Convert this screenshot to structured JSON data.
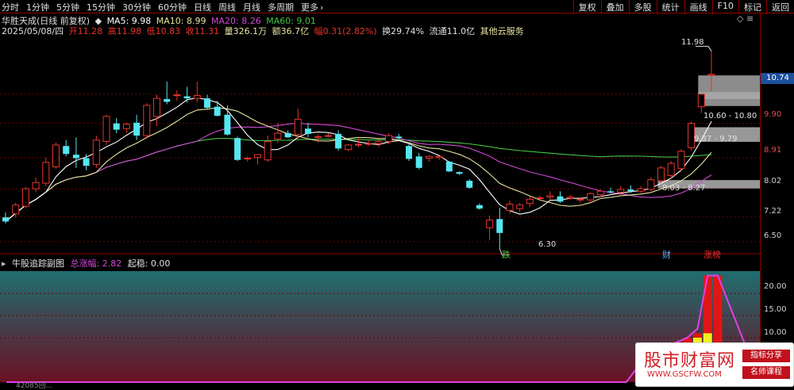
{
  "toolbar": {
    "periods": [
      "分时",
      "1分钟",
      "5分钟",
      "15分钟",
      "30分钟",
      "60分钟",
      "日线",
      "周线",
      "月线",
      "多周期",
      "更多"
    ],
    "more_arrow": "›",
    "right_tools": [
      "复权",
      "叠加",
      "多股",
      "统计",
      "画线",
      "F10",
      "标记",
      "返回"
    ]
  },
  "info": {
    "stock_name": "华胜天成(日线 前复权)",
    "ma_toggle": "◆",
    "ma5": "MA5: 9.98",
    "ma10": "MA10: 8.99",
    "ma20": "MA20: 8.26",
    "ma60": "MA60: 9.01",
    "date": "2025/05/08/四",
    "open": "开11.28",
    "high": "高11.98",
    "low": "低10.83",
    "close": "收11.31",
    "volume": "量326.1万",
    "amount": "额36.7亿",
    "range": "幅0.31(2.82%)",
    "turnover": "换29.74%",
    "float_cap": "流通11.0亿",
    "cloud": "其他云服务",
    "corner_icons": "◇ ≡"
  },
  "axis": {
    "labels": [
      "10.74",
      "9.90",
      "8.91",
      "8.02",
      "7.22",
      "6.50"
    ],
    "current_price": "10.74",
    "sub_labels": [
      "20.00",
      "15.00",
      "10.00"
    ]
  },
  "annotations": {
    "high_label": "11.98",
    "low_label": "6.30",
    "zone1": "10.60 - 10.80",
    "zone2": "9.37 - 9.79",
    "zone3": "8.03 - 8.27",
    "tag_die": "跌",
    "tag_cai": "财",
    "tag_zhangting": "涨榜"
  },
  "sub_chart": {
    "name": "牛股追踪副图",
    "total_label": "总涨幅: 2.82",
    "qiwen_label": "起稳: 0.00"
  },
  "bottom_text": "42085回...",
  "watermark": {
    "title": "股市财富网",
    "url": "WWW.GSCFW.COM",
    "badge1": "指标分享",
    "badge2": "名师课程"
  },
  "colors": {
    "up": "#e8342d",
    "down": "#55e6f0",
    "ma5": "#ffffff",
    "ma10": "#e8e4a0",
    "ma20": "#d14ad6",
    "ma60": "#44c444"
  },
  "chart_data": {
    "type": "candlestick",
    "ylim": [
      6.2,
      12.4
    ],
    "candles": [
      {
        "o": 7.2,
        "h": 7.34,
        "l": 7.02,
        "c": 7.08
      },
      {
        "o": 7.3,
        "h": 7.62,
        "l": 7.2,
        "c": 7.55
      },
      {
        "o": 7.52,
        "h": 8.08,
        "l": 7.46,
        "c": 8.02
      },
      {
        "o": 8.02,
        "h": 8.35,
        "l": 7.92,
        "c": 8.2
      },
      {
        "o": 8.18,
        "h": 8.92,
        "l": 8.1,
        "c": 8.78
      },
      {
        "o": 8.65,
        "h": 9.35,
        "l": 8.6,
        "c": 9.28
      },
      {
        "o": 9.25,
        "h": 9.42,
        "l": 8.95,
        "c": 9.02
      },
      {
        "o": 9.0,
        "h": 9.5,
        "l": 8.62,
        "c": 8.9
      },
      {
        "o": 8.9,
        "h": 9.02,
        "l": 8.55,
        "c": 8.68
      },
      {
        "o": 8.72,
        "h": 9.55,
        "l": 8.62,
        "c": 9.42
      },
      {
        "o": 9.38,
        "h": 10.15,
        "l": 9.28,
        "c": 10.1
      },
      {
        "o": 9.9,
        "h": 10.05,
        "l": 9.62,
        "c": 9.72
      },
      {
        "o": 9.75,
        "h": 9.92,
        "l": 9.62,
        "c": 9.88
      },
      {
        "o": 9.92,
        "h": 10.15,
        "l": 9.42,
        "c": 9.55
      },
      {
        "o": 9.55,
        "h": 10.48,
        "l": 9.45,
        "c": 10.42
      },
      {
        "o": 10.1,
        "h": 10.72,
        "l": 9.82,
        "c": 10.62
      },
      {
        "o": 10.6,
        "h": 11.1,
        "l": 10.45,
        "c": 10.52
      },
      {
        "o": 10.72,
        "h": 10.85,
        "l": 10.55,
        "c": 10.72
      },
      {
        "o": 10.68,
        "h": 10.95,
        "l": 10.5,
        "c": 10.62
      },
      {
        "o": 10.62,
        "h": 11.1,
        "l": 10.5,
        "c": 10.7
      },
      {
        "o": 10.62,
        "h": 10.72,
        "l": 10.3,
        "c": 10.35
      },
      {
        "o": 10.38,
        "h": 10.55,
        "l": 10.1,
        "c": 10.12
      },
      {
        "o": 10.15,
        "h": 10.42,
        "l": 9.55,
        "c": 9.58
      },
      {
        "o": 9.48,
        "h": 9.52,
        "l": 8.82,
        "c": 8.85
      },
      {
        "o": 8.9,
        "h": 8.95,
        "l": 8.8,
        "c": 8.9
      },
      {
        "o": 8.92,
        "h": 9.02,
        "l": 8.72,
        "c": 9.0
      },
      {
        "o": 8.85,
        "h": 9.55,
        "l": 8.8,
        "c": 9.38
      },
      {
        "o": 9.45,
        "h": 9.92,
        "l": 9.35,
        "c": 9.62
      },
      {
        "o": 9.62,
        "h": 9.7,
        "l": 9.48,
        "c": 9.5
      },
      {
        "o": 9.58,
        "h": 10.32,
        "l": 9.45,
        "c": 10.02
      },
      {
        "o": 9.75,
        "h": 9.92,
        "l": 9.5,
        "c": 9.6
      },
      {
        "o": 9.52,
        "h": 9.58,
        "l": 9.35,
        "c": 9.52
      },
      {
        "o": 9.55,
        "h": 9.62,
        "l": 9.5,
        "c": 9.55
      },
      {
        "o": 9.6,
        "h": 9.7,
        "l": 9.12,
        "c": 9.18
      },
      {
        "o": 9.15,
        "h": 9.3,
        "l": 9.1,
        "c": 9.28
      },
      {
        "o": 9.3,
        "h": 9.45,
        "l": 9.22,
        "c": 9.3
      },
      {
        "o": 9.32,
        "h": 9.42,
        "l": 9.25,
        "c": 9.32
      },
      {
        "o": 9.32,
        "h": 9.42,
        "l": 9.22,
        "c": 9.38
      },
      {
        "o": 9.38,
        "h": 9.62,
        "l": 9.3,
        "c": 9.55
      },
      {
        "o": 9.52,
        "h": 9.6,
        "l": 9.45,
        "c": 9.48
      },
      {
        "o": 9.25,
        "h": 9.3,
        "l": 8.82,
        "c": 8.88
      },
      {
        "o": 8.95,
        "h": 9.05,
        "l": 8.58,
        "c": 8.62
      },
      {
        "o": 8.9,
        "h": 8.98,
        "l": 8.8,
        "c": 8.95
      },
      {
        "o": 8.92,
        "h": 8.95,
        "l": 8.85,
        "c": 8.95
      },
      {
        "o": 8.8,
        "h": 8.82,
        "l": 8.5,
        "c": 8.52
      },
      {
        "o": 8.5,
        "h": 8.52,
        "l": 8.42,
        "c": 8.45
      },
      {
        "o": 8.25,
        "h": 8.3,
        "l": 8.02,
        "c": 8.05
      },
      {
        "o": 7.55,
        "h": 7.6,
        "l": 7.42,
        "c": 7.45
      },
      {
        "o": 6.9,
        "h": 7.25,
        "l": 6.55,
        "c": 7.12
      },
      {
        "o": 7.15,
        "h": 7.48,
        "l": 6.3,
        "c": 6.75
      },
      {
        "o": 7.4,
        "h": 7.68,
        "l": 7.3,
        "c": 7.58
      },
      {
        "o": 7.45,
        "h": 7.62,
        "l": 7.35,
        "c": 7.55
      },
      {
        "o": 7.6,
        "h": 7.8,
        "l": 7.5,
        "c": 7.72
      },
      {
        "o": 7.75,
        "h": 7.82,
        "l": 7.7,
        "c": 7.76
      },
      {
        "o": 7.78,
        "h": 7.95,
        "l": 7.7,
        "c": 7.82
      },
      {
        "o": 7.8,
        "h": 7.95,
        "l": 7.62,
        "c": 7.65
      },
      {
        "o": 7.75,
        "h": 7.85,
        "l": 7.7,
        "c": 7.78
      },
      {
        "o": 7.7,
        "h": 7.78,
        "l": 7.62,
        "c": 7.72
      },
      {
        "o": 7.7,
        "h": 7.92,
        "l": 7.65,
        "c": 7.88
      },
      {
        "o": 7.85,
        "h": 8.0,
        "l": 7.78,
        "c": 7.95
      },
      {
        "o": 7.95,
        "h": 8.05,
        "l": 7.88,
        "c": 7.92
      },
      {
        "o": 7.92,
        "h": 8.1,
        "l": 7.85,
        "c": 8.0
      },
      {
        "o": 8.0,
        "h": 8.12,
        "l": 7.9,
        "c": 7.95
      },
      {
        "o": 7.95,
        "h": 8.1,
        "l": 7.9,
        "c": 8.02
      },
      {
        "o": 8.0,
        "h": 8.35,
        "l": 7.95,
        "c": 8.28
      },
      {
        "o": 8.25,
        "h": 8.68,
        "l": 8.18,
        "c": 8.62
      },
      {
        "o": 8.4,
        "h": 8.82,
        "l": 8.3,
        "c": 8.75
      },
      {
        "o": 8.6,
        "h": 9.15,
        "l": 8.55,
        "c": 9.1
      },
      {
        "o": 9.2,
        "h": 9.95,
        "l": 9.12,
        "c": 9.9
      },
      {
        "o": 10.38,
        "h": 10.74,
        "l": 10.2,
        "c": 10.74
      },
      {
        "o": 11.28,
        "h": 11.98,
        "l": 10.83,
        "c": 11.31
      }
    ],
    "zones": [
      {
        "low": 10.6,
        "high": 10.8,
        "label": "10.60 - 10.80"
      },
      {
        "low": 9.37,
        "high": 9.79,
        "label": "9.37 - 9.79"
      },
      {
        "low": 8.03,
        "high": 8.27,
        "label": "8.03 - 8.27"
      }
    ],
    "upper_zone": {
      "low": 10.4,
      "high": 11.28
    },
    "sub": {
      "ylim": [
        0,
        25
      ],
      "red_bars": [
        0,
        0,
        0,
        0,
        0,
        0,
        0,
        0,
        0,
        0,
        0,
        0,
        0,
        0,
        0,
        0,
        0,
        0,
        0,
        0,
        0,
        0,
        0,
        0,
        0,
        0,
        0,
        0,
        0,
        0,
        0,
        0,
        0,
        0,
        0,
        0,
        0,
        0,
        0,
        0,
        0,
        0,
        0,
        0,
        0,
        0,
        0,
        0,
        0,
        0,
        0,
        0,
        0,
        0,
        0,
        0,
        0,
        0,
        0,
        0,
        0,
        0,
        0,
        4,
        6,
        8,
        9,
        10,
        11,
        24,
        24
      ],
      "yellow_bars": [
        0,
        0,
        0,
        0,
        0,
        0,
        0,
        0,
        0,
        0,
        0,
        0,
        0,
        0,
        0,
        0,
        0,
        0,
        0,
        0,
        0,
        0,
        0,
        0,
        0,
        0,
        0,
        0,
        0,
        0,
        0,
        0,
        0,
        0,
        0,
        0,
        0,
        0,
        0,
        0,
        0,
        0,
        0,
        0,
        0,
        0,
        0,
        0,
        0,
        0,
        0,
        0,
        0,
        0,
        0,
        0,
        0,
        0,
        0,
        0,
        0,
        0,
        0,
        0,
        3,
        4,
        5,
        6,
        10,
        11,
        0
      ],
      "green_bars": [
        0,
        0,
        0,
        0,
        0,
        0,
        0,
        0,
        0,
        0,
        0,
        0,
        0,
        0,
        0,
        0,
        0,
        0,
        0,
        0,
        0,
        0,
        0,
        0,
        0,
        0,
        0,
        0,
        0,
        0,
        0,
        0,
        0,
        0,
        0,
        0,
        0,
        0,
        0,
        0,
        0,
        0,
        0,
        0,
        0,
        0,
        0,
        0,
        0,
        0,
        0,
        0,
        0,
        0,
        0,
        0,
        0,
        0,
        0,
        0,
        0,
        0,
        0,
        1,
        0,
        0,
        0,
        0,
        0,
        0,
        6
      ],
      "blue_bars": [
        0,
        0,
        0,
        0,
        0,
        0,
        0,
        0,
        0,
        0,
        0,
        0,
        0,
        0,
        0,
        0,
        0,
        0,
        0,
        0,
        0,
        0,
        0,
        0,
        0,
        0,
        0,
        0,
        0,
        0,
        0,
        0,
        0,
        0,
        0,
        0,
        0,
        0,
        0,
        0,
        0,
        0,
        0,
        0,
        0,
        0,
        0,
        0,
        0,
        0,
        0,
        0,
        0,
        0,
        0,
        0,
        0,
        0,
        0,
        0,
        0,
        0,
        0,
        3,
        0,
        0,
        0,
        0,
        0,
        0,
        0
      ],
      "magenta_line": [
        0,
        0,
        0,
        0,
        0,
        0,
        0,
        0,
        0,
        0,
        0,
        0,
        0,
        0,
        0,
        0,
        0,
        0,
        0,
        0,
        0,
        0,
        0,
        0,
        0,
        0,
        0,
        0,
        0,
        0,
        0,
        0,
        0,
        0,
        0,
        0,
        0,
        0,
        0,
        0,
        0,
        0,
        0,
        0,
        0,
        0,
        0,
        0,
        0,
        0,
        0,
        0,
        0,
        0,
        0,
        0,
        0,
        0,
        0,
        0,
        0,
        0,
        3,
        6,
        8,
        8,
        9,
        10,
        12,
        24,
        24
      ]
    }
  }
}
